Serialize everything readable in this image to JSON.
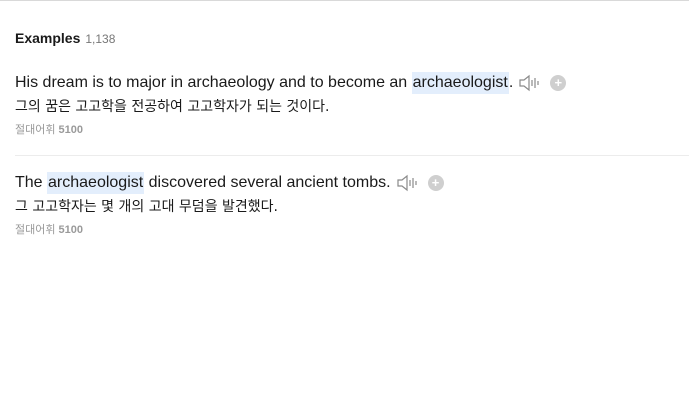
{
  "section": {
    "title": "Examples",
    "count": "1,138"
  },
  "examples": [
    {
      "en_before": "His dream is to major in archaeology and to become an ",
      "en_highlight": "archaeologist",
      "en_after": ".",
      "ko": "그의 꿈은 고고학을 전공하여 고고학자가 되는 것이다.",
      "source_name": "절대어휘",
      "source_num": "5100"
    },
    {
      "en_before": "The ",
      "en_highlight": "archaeologist",
      "en_after": " discovered several ancient tombs.",
      "ko": "그 고고학자는 몇 개의 고대 무덤을 발견했다.",
      "source_name": "절대어휘",
      "source_num": "5100"
    }
  ],
  "icons": {
    "speaker": "speaker-icon",
    "add": "plus-circle-icon",
    "add_glyph": "+"
  },
  "colors": {
    "highlight": "#e3eefc",
    "muted": "#999999",
    "icon_grey": "#cfcfcf"
  }
}
